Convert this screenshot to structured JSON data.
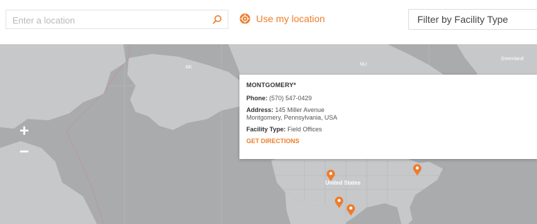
{
  "search": {
    "placeholder": "Enter a location"
  },
  "use_location": {
    "label": "Use my location"
  },
  "filter": {
    "label": "Filter by Facility Type"
  },
  "zoom": {
    "in": "+",
    "out": "−"
  },
  "map": {
    "greenland_label": "Greenland",
    "us_label": "United States"
  },
  "popup": {
    "title": "MONTGOMERY*",
    "phone_key": "Phone:",
    "phone": "(570) 547-0429",
    "address_key": "Address:",
    "address_line1": "145 Miller Avenue",
    "address_line2": "Montgomery, Pennsylvania, USA",
    "facility_key": "Facility Type:",
    "facility": "Field Offices",
    "directions": "GET DIRECTIONS"
  },
  "colors": {
    "accent": "#ee7c2c",
    "map_bg": "#a9abad",
    "land": "#c7c8ca"
  }
}
